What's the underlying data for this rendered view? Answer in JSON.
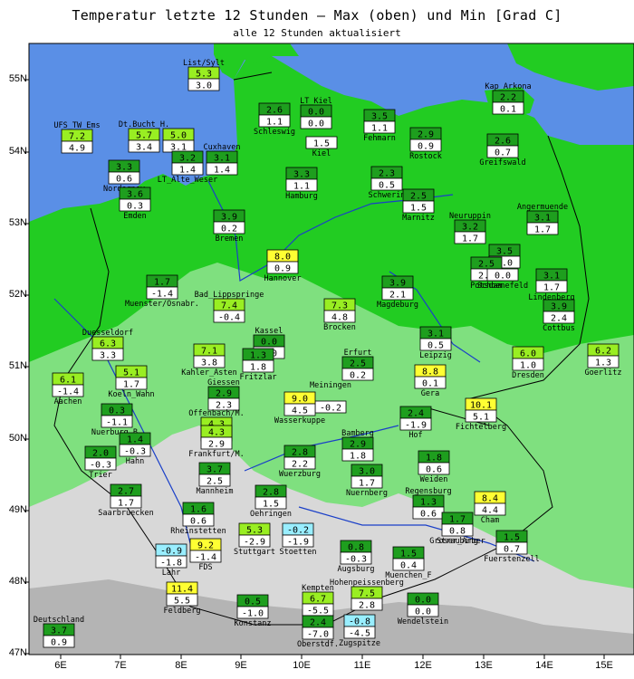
{
  "header": {
    "title": "Temperatur letzte 12 Stunden — Max (oben) und Min [Grad C]",
    "subtitle": "alle 12 Stunden aktualisiert"
  },
  "axes": {
    "lon_labels": [
      "6E",
      "7E",
      "8E",
      "9E",
      "10E",
      "11E",
      "12E",
      "13E",
      "14E",
      "15E"
    ],
    "lat_labels": [
      "55N",
      "54N",
      "53N",
      "52N",
      "51N",
      "50N",
      "49N",
      "48N",
      "47N"
    ]
  },
  "colors": {
    "sea": "#5a8fe6",
    "land_low": "#22cc22",
    "land_mid": "#7fe07f",
    "land_high": "#d8d8d8",
    "max_green": "#1e9e1e",
    "max_lightgreen": "#99ee22",
    "max_yellow": "#ffff33",
    "max_cyan": "#99eeff"
  },
  "stations": [
    {
      "name": "List/Sylt",
      "max": "5.3",
      "min": "3.0",
      "c": "lightgreen"
    },
    {
      "name": "LT_Kiel",
      "max": "0.0",
      "min": "0.0",
      "c": "green"
    },
    {
      "name": "Schleswig",
      "max": "2.6",
      "min": "1.1",
      "c": "green"
    },
    {
      "name": "Kiel",
      "max": "",
      "min": "1.5",
      "c": "green"
    },
    {
      "name": "Fehmarn",
      "max": "3.5",
      "min": "1.1",
      "c": "green"
    },
    {
      "name": "Kap_Arkona",
      "max": "2.2",
      "min": "0.1",
      "c": "green"
    },
    {
      "name": "UFS_TW_Ems",
      "max": "7.2",
      "min": "4.9",
      "c": "lightgreen"
    },
    {
      "name": "Dt.Bucht_H.",
      "max": "5.7",
      "min": "3.4",
      "c": "lightgreen"
    },
    {
      "name": "",
      "max": "5.0",
      "min": "3.1",
      "c": "lightgreen"
    },
    {
      "name": "Cuxhaven",
      "max": "3.1",
      "min": "1.4",
      "c": "green"
    },
    {
      "name": "Norderney",
      "max": "3.3",
      "min": "0.6",
      "c": "green"
    },
    {
      "name": "LT_Alte_Weser",
      "max": "3.2",
      "min": "1.4",
      "c": "green"
    },
    {
      "name": "Rostock",
      "max": "2.9",
      "min": "0.9",
      "c": "green"
    },
    {
      "name": "Greifswald",
      "max": "2.6",
      "min": "0.7",
      "c": "green"
    },
    {
      "name": "Hamburg",
      "max": "3.3",
      "min": "1.1",
      "c": "green"
    },
    {
      "name": "Schwerin",
      "max": "2.3",
      "min": "0.5",
      "c": "green"
    },
    {
      "name": "Emden",
      "max": "3.6",
      "min": "0.3",
      "c": "green"
    },
    {
      "name": "Marnitz",
      "max": "2.5",
      "min": "1.5",
      "c": "green"
    },
    {
      "name": "Neuruppin",
      "max": "3.2",
      "min": "1.7",
      "c": "green"
    },
    {
      "name": "Angermuende",
      "max": "3.1",
      "min": "1.7",
      "c": "green"
    },
    {
      "name": "Bremen",
      "max": "3.9",
      "min": "0.2",
      "c": "green"
    },
    {
      "name": "Tegel",
      "max": "3.5",
      "min": "0.0",
      "c": "green"
    },
    {
      "name": "Hannover",
      "max": "8.0",
      "min": "0.9",
      "c": "yellow"
    },
    {
      "name": "Potsdam",
      "max": "2.5",
      "min": "2.2",
      "c": "green"
    },
    {
      "name": "Schoenefeld",
      "max": "",
      "min": "0.0",
      "c": "green"
    },
    {
      "name": "Muenster/Osnabr.",
      "max": "1.7",
      "min": "-1.4",
      "c": "green"
    },
    {
      "name": "Magdeburg",
      "max": "3.9",
      "min": "2.1",
      "c": "green"
    },
    {
      "name": "Lindenberg",
      "max": "3.1",
      "min": "1.7",
      "c": "green"
    },
    {
      "name": "Bad_Lippspringe",
      "max": "7.4",
      "min": "-0.4",
      "c": "lightgreen"
    },
    {
      "name": "Brocken",
      "max": "7.3",
      "min": "4.8",
      "c": "lightgreen"
    },
    {
      "name": "Cottbus",
      "max": "3.9",
      "min": "2.4",
      "c": "green"
    },
    {
      "name": "Duesseldorf",
      "max": "6.3",
      "min": "3.3",
      "c": "lightgreen"
    },
    {
      "name": "Kassel",
      "max": "0.0",
      "min": "0.0",
      "c": "green"
    },
    {
      "name": "Leipzig",
      "max": "3.1",
      "min": "0.5",
      "c": "green"
    },
    {
      "name": "Koeln_Wahn",
      "max": "5.1",
      "min": "1.7",
      "c": "lightgreen"
    },
    {
      "name": "Kahler_Asten",
      "max": "7.1",
      "min": "3.8",
      "c": "lightgreen"
    },
    {
      "name": "Fritzlar",
      "max": "1.3",
      "min": "1.8",
      "c": "green"
    },
    {
      "name": "Erfurt",
      "max": "2.5",
      "min": "0.2",
      "c": "green"
    },
    {
      "name": "Dresden",
      "max": "6.0",
      "min": "1.0",
      "c": "lightgreen"
    },
    {
      "name": "Goerlitz",
      "max": "6.2",
      "min": "1.3",
      "c": "lightgreen"
    },
    {
      "name": "Aachen",
      "max": "6.1",
      "min": "-1.4",
      "c": "lightgreen"
    },
    {
      "name": "Giessen",
      "max": "2.9",
      "min": "2.3",
      "c": "green"
    },
    {
      "name": "Meiningen",
      "max": "",
      "min": "-0.2",
      "c": "green"
    },
    {
      "name": "Gera",
      "max": "8.8",
      "min": "0.1",
      "c": "yellow"
    },
    {
      "name": "Nuerburg_B.",
      "max": "0.3",
      "min": "-1.1",
      "c": "green"
    },
    {
      "name": "Wasserkuppe",
      "max": "9.0",
      "min": "4.5",
      "c": "yellow"
    },
    {
      "name": "Offenbach/M.",
      "max": "4.3",
      "min": "4.1",
      "c": "lightgreen"
    },
    {
      "name": "Hof",
      "max": "2.4",
      "min": "-1.9",
      "c": "green"
    },
    {
      "name": "Fichtelberg",
      "max": "10.1",
      "min": "5.1",
      "c": "yellow"
    },
    {
      "name": "Frankfurt/M.",
      "max": "4.3",
      "min": "2.9",
      "c": "lightgreen"
    },
    {
      "name": "Bamberg",
      "max": "2.9",
      "min": "1.8",
      "c": "green"
    },
    {
      "name": "Hahn",
      "max": "1.4",
      "min": "-0.3",
      "c": "green"
    },
    {
      "name": "Trier",
      "max": "2.0",
      "min": "-0.3",
      "c": "green"
    },
    {
      "name": "Wuerzburg",
      "max": "2.8",
      "min": "2.2",
      "c": "green"
    },
    {
      "name": "Weiden",
      "max": "1.8",
      "min": "0.6",
      "c": "green"
    },
    {
      "name": "Mannheim",
      "max": "3.7",
      "min": "2.5",
      "c": "green"
    },
    {
      "name": "Nuernberg",
      "max": "3.0",
      "min": "1.7",
      "c": "green"
    },
    {
      "name": "Saarbruecken",
      "max": "2.7",
      "min": "1.7",
      "c": "green"
    },
    {
      "name": "Oehringen",
      "max": "2.8",
      "min": "1.5",
      "c": "green"
    },
    {
      "name": "Regensburg",
      "max": "1.3",
      "min": "0.6",
      "c": "green"
    },
    {
      "name": "Cham",
      "max": "8.4",
      "min": "4.4",
      "c": "yellow"
    },
    {
      "name": "Rheinstetten",
      "max": "1.6",
      "min": "0.6",
      "c": "green"
    },
    {
      "name": "Groser_Arber",
      "max": "1.7",
      "min": "0.8",
      "c": "green"
    },
    {
      "name": "Straubing",
      "max": "",
      "min": "",
      "c": "green"
    },
    {
      "name": "Stuttgart",
      "max": "5.3",
      "min": "-2.9",
      "c": "lightgreen"
    },
    {
      "name": "Stoetten",
      "max": "-0.2",
      "min": "-1.9",
      "c": "cyan"
    },
    {
      "name": "Fuerstenzell",
      "max": "1.5",
      "min": "0.7",
      "c": "green"
    },
    {
      "name": "Lahr",
      "max": "-0.9",
      "min": "-1.8",
      "c": "cyan"
    },
    {
      "name": "FDS",
      "max": "9.2",
      "min": "-1.4",
      "c": "yellow"
    },
    {
      "name": "Augsburg",
      "max": "0.8",
      "min": "-0.3",
      "c": "green"
    },
    {
      "name": "Muenchen_F",
      "max": "1.5",
      "min": "0.4",
      "c": "green"
    },
    {
      "name": "Feldberg",
      "max": "11.4",
      "min": "5.5",
      "c": "yellow"
    },
    {
      "name": "Kempten",
      "max": "6.7",
      "min": "-5.5",
      "c": "lightgreen"
    },
    {
      "name": "Hohenpeissenberg",
      "max": "7.5",
      "min": "2.8",
      "c": "lightgreen"
    },
    {
      "name": "Konstanz",
      "max": "0.5",
      "min": "-1.0",
      "c": "green"
    },
    {
      "name": "Wendelstein",
      "max": "0.0",
      "min": "0.0",
      "c": "green"
    },
    {
      "name": "Deutschland",
      "max": "3.7",
      "min": "0.9",
      "c": "green"
    },
    {
      "name": "Oberstdf.",
      "max": "2.4",
      "min": "-7.0",
      "c": "green"
    },
    {
      "name": "Zugspitze",
      "max": "-0.8",
      "min": "-4.5",
      "c": "cyan"
    }
  ]
}
